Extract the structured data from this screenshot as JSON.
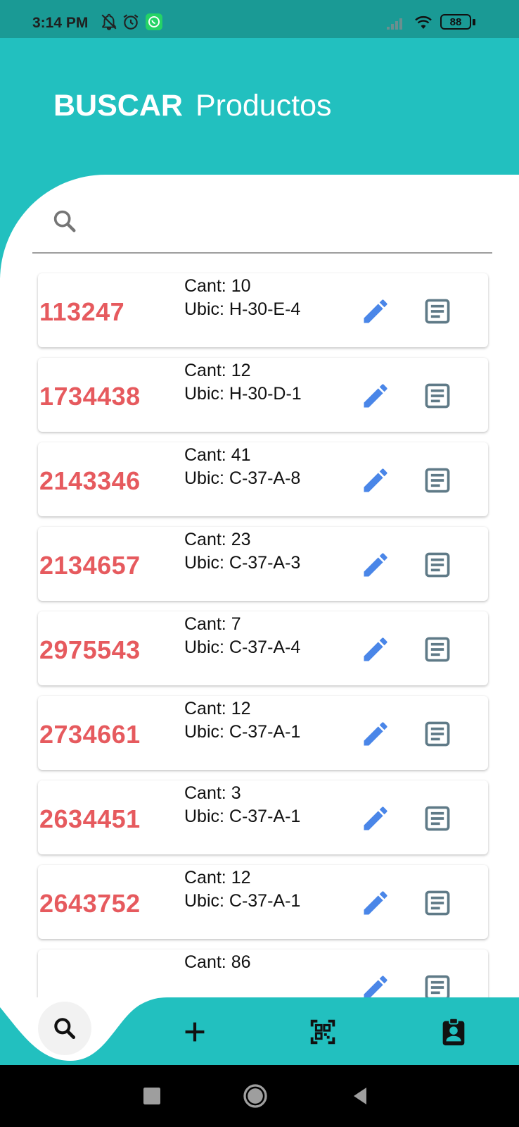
{
  "status_bar": {
    "time": "3:14 PM",
    "battery": "88",
    "icons": [
      "bell-off-icon",
      "alarm-icon",
      "whatsapp-icon",
      "signal-icon",
      "wifi-icon",
      "battery-icon"
    ],
    "color": "#1a9a95"
  },
  "header": {
    "title_bold": "BUSCAR",
    "title_light": "Productos",
    "color": "#22c0bf"
  },
  "search": {
    "placeholder": "",
    "value": ""
  },
  "products": [
    {
      "code": "113247",
      "qty": "Cant: 10",
      "loc": "Ubic: H-30-E-4"
    },
    {
      "code": "1734438",
      "qty": "Cant: 12",
      "loc": "Ubic: H-30-D-1"
    },
    {
      "code": "2143346",
      "qty": "Cant: 41",
      "loc": "Ubic: C-37-A-8"
    },
    {
      "code": "2134657",
      "qty": "Cant: 23",
      "loc": "Ubic: C-37-A-3"
    },
    {
      "code": "2975543",
      "qty": "Cant: 7",
      "loc": "Ubic: C-37-A-4"
    },
    {
      "code": "2734661",
      "qty": "Cant: 12",
      "loc": "Ubic: C-37-A-1"
    },
    {
      "code": "2634451",
      "qty": "Cant: 3",
      "loc": "Ubic: C-37-A-1"
    },
    {
      "code": "2643752",
      "qty": "Cant: 12",
      "loc": "Ubic: C-37-A-1"
    },
    {
      "code": "",
      "qty": "Cant: 86",
      "loc": ""
    }
  ],
  "colors": {
    "code": "#e65a5e",
    "edit_icon": "#4a86e8",
    "detail_icon": "#5f7a87"
  },
  "bottom_nav": {
    "items": [
      "search-icon",
      "add-icon",
      "qr-code-icon",
      "assignment-ind-icon"
    ],
    "active": "search-icon"
  },
  "system_nav": {
    "items": [
      "recents-icon",
      "home-icon",
      "back-icon"
    ]
  }
}
